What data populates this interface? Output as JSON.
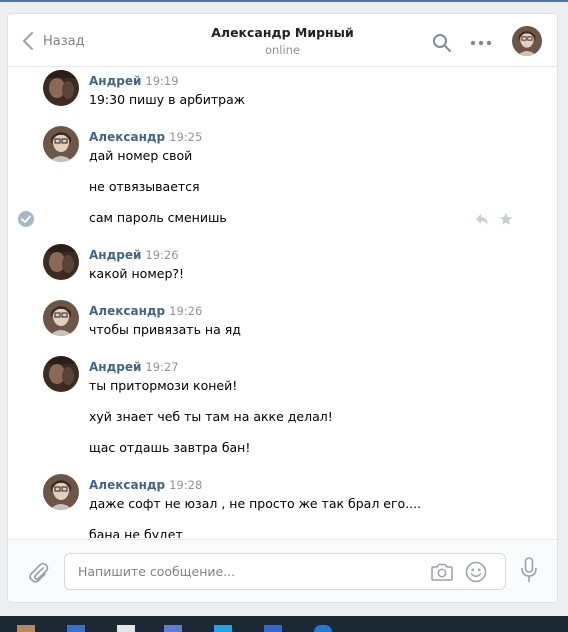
{
  "header": {
    "back_label": "Назад",
    "peer_name": "Александр Мирный",
    "peer_status": "online",
    "icons": [
      "chevron-left-icon",
      "search-icon",
      "more-icon",
      "peer-avatar"
    ]
  },
  "groups": [
    {
      "author": "Андрей",
      "time": "19:19",
      "avatar": "andrey",
      "messages": [
        "19:30 пишу в арбитраж"
      ]
    },
    {
      "author": "Александр",
      "time": "19:25",
      "avatar": "alexander",
      "messages": [
        "дай номер свой",
        "не отвязывается",
        "сам пароль сменишь"
      ]
    },
    {
      "author": "Андрей",
      "time": "19:26",
      "avatar": "andrey",
      "messages": [
        "какой номер?!"
      ]
    },
    {
      "author": "Александр",
      "time": "19:26",
      "avatar": "alexander",
      "messages": [
        "чтобы привязать на яд"
      ]
    },
    {
      "author": "Андрей",
      "time": "19:27",
      "avatar": "andrey",
      "messages": [
        "ты притормози коней!",
        "хуй знает чеб ты там на акке делал!",
        "щас отдашь завтра бан!"
      ]
    },
    {
      "author": "Александр",
      "time": "19:28",
      "avatar": "alexander",
      "messages": [
        "даже софт не юзал , не просто же так брал его....",
        "бана не будет"
      ]
    }
  ],
  "selected_message": {
    "group": 1,
    "message": 2,
    "actions": [
      "reply-icon",
      "star-icon"
    ]
  },
  "composer": {
    "placeholder": "Напишите сообщение...",
    "icons": [
      "attach-icon",
      "camera-icon",
      "emoji-icon",
      "microphone-icon"
    ]
  },
  "colors": {
    "accent": "#4a76a8",
    "author": "#42648b",
    "time": "#939393",
    "check": "#a8b8cc"
  }
}
